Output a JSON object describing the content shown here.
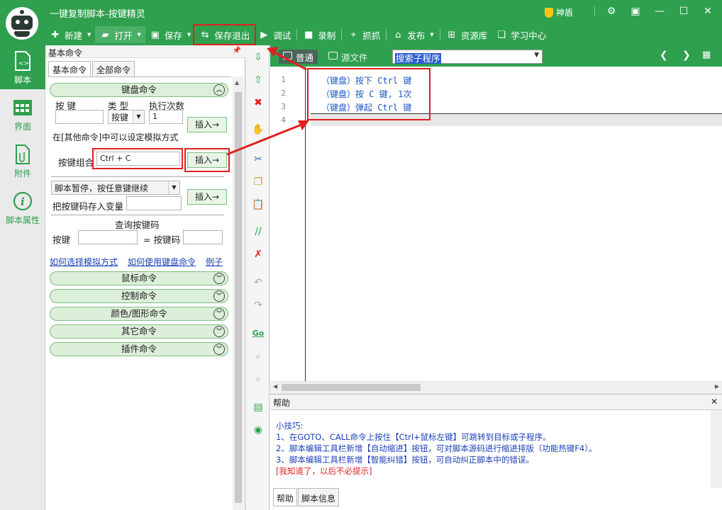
{
  "app": {
    "title": "一键复制脚本-按键精灵",
    "shield_label": "神盾"
  },
  "toolbar": {
    "new": "新建",
    "open": "打开",
    "save": "保存",
    "save_exit": "保存退出",
    "debug": "调试",
    "record": "录制",
    "grab": "抓抓",
    "publish": "发布",
    "library": "资源库",
    "learn": "学习中心"
  },
  "sidenav": {
    "items": [
      {
        "label": "脚本",
        "icon": "script-icon"
      },
      {
        "label": "界面",
        "icon": "ui-grid-icon"
      },
      {
        "label": "附件",
        "icon": "attachment-icon"
      },
      {
        "label": "脚本属性",
        "icon": "info-icon"
      }
    ]
  },
  "cmdpanel": {
    "title": "基本命令",
    "tabs": [
      "基本命令",
      "全部命令"
    ],
    "keyboard": {
      "header": "键盘命令",
      "col_key": "按 键",
      "col_type": "类 型",
      "col_count": "执行次数",
      "type_value": "按键",
      "count_value": "1",
      "insert": "插入→",
      "hint": "在[其他命令]中可以设定模拟方式",
      "combo_label": "按键组合",
      "combo_value": "Ctrl + C",
      "pause_select": "脚本暂停，按任意键继续",
      "store_label": "把按键码存入变量",
      "query_title": "查询按键码",
      "query_key": "按键",
      "query_code": "= 按键码"
    },
    "links": [
      "如何选择模拟方式",
      "如何使用键盘命令",
      "例子"
    ],
    "groups": [
      "鼠标命令",
      "控制命令",
      "颜色/图形命令",
      "其它命令",
      "插件命令"
    ]
  },
  "editor": {
    "mode_normal": "普通",
    "mode_source": "源文件",
    "sub_select": "搜索子程序",
    "lines": [
      {
        "n": "1",
        "text": "（键盘）按下 Ctrl 键"
      },
      {
        "n": "2",
        "text": "（键盘）按 C 键, 1次"
      },
      {
        "n": "3",
        "text": "（键盘）弹起 Ctrl 键"
      },
      {
        "n": "4",
        "text": ""
      }
    ]
  },
  "help": {
    "title": "帮助",
    "tip_title": "小技巧:",
    "tips": [
      "1、在GOTO、CALL命令上按住【Ctrl+鼠标左键】可跳转到目标或子程序。",
      "2、脚本编辑工具栏新增【自动缩进】按钮，可对脚本源码进行缩进排版（功能热键F4）。",
      "3、脚本编辑工具栏新增【智能纠错】按钮，可自动纠正脚本中的错误。"
    ],
    "dismiss": "[我知道了，以后不必提示]",
    "tabs": [
      "帮助",
      "脚本信息"
    ]
  },
  "colors": {
    "brand_green": "#2ea04e",
    "highlight_red": "#e02020",
    "code_blue": "#1a55c8"
  }
}
